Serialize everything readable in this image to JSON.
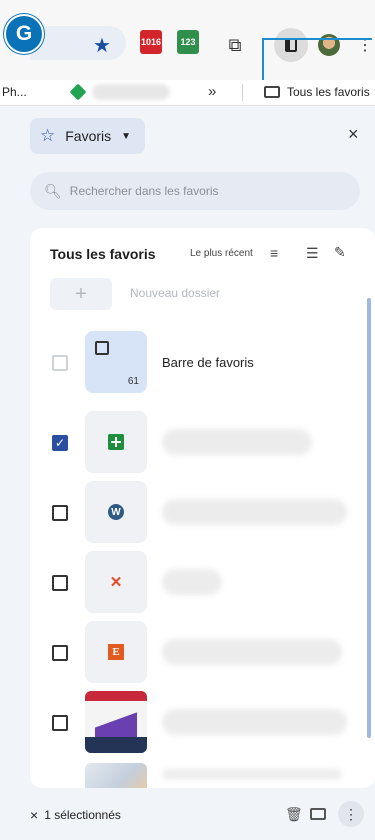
{
  "badge": {
    "letter": "G",
    "color": "#0a73b8"
  },
  "toolbar": {
    "icons": [
      "star-icon",
      "calendar-red-icon",
      "calendar-green-icon",
      "puzzle-icon",
      "side-panel-icon",
      "avatar",
      "kebab-icon"
    ],
    "calendar_red_text": "1016",
    "calendar_green_text": "123",
    "annotation_color": "#1c8dd1"
  },
  "bookmark_bar": {
    "first_item": "Ph...",
    "overflow": "»",
    "folder_label": "Tous les favoris"
  },
  "panel": {
    "header_label": "Favoris",
    "close": "×",
    "search_placeholder": "Rechercher dans les favoris",
    "list_title": "Tous les favoris",
    "sort_label": "Le plus récent",
    "new_folder_plus": "+",
    "new_folder_label": "Nouveau dossier",
    "items": [
      {
        "type": "folder",
        "label": "Barre de favoris",
        "count": "61",
        "checked": false,
        "disabled": true
      },
      {
        "type": "site",
        "icon": "google-sheets-icon",
        "checked": true
      },
      {
        "type": "site",
        "icon": "wordpress-icon",
        "glyph": "W",
        "checked": false
      },
      {
        "type": "site",
        "icon": "joomla-icon",
        "checked": false
      },
      {
        "type": "site",
        "icon": "etsy-icon",
        "glyph": "E",
        "checked": false
      },
      {
        "type": "site",
        "icon": "article-thumbnail",
        "checked": false
      },
      {
        "type": "site",
        "icon": "article-thumbnail",
        "checked": false
      }
    ],
    "footer": {
      "close": "×",
      "selection_text": "1 sélectionnés"
    }
  },
  "colors": {
    "accent": "#2a4fa0",
    "panel_bg": "#f1f4f9",
    "folder_tile": "#d7e3f6"
  }
}
